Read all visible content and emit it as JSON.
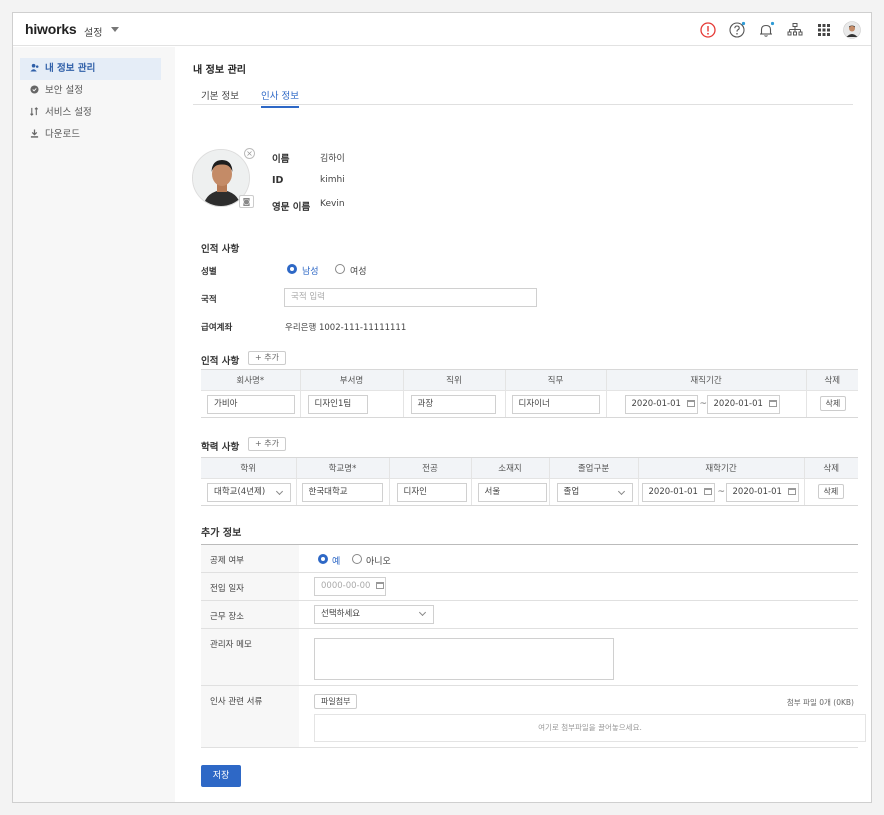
{
  "app": {
    "logo": "hiworks",
    "section": "설정"
  },
  "topbar": {
    "icons": [
      "alert-icon",
      "help-icon",
      "bell-icon",
      "org-chart-icon",
      "apps-grid-icon",
      "user-avatar"
    ]
  },
  "sidebar": {
    "items": [
      {
        "label": "내 정보 관리",
        "icon": "person-icon",
        "active": true
      },
      {
        "label": "보안 설정",
        "icon": "shield-icon",
        "active": false
      },
      {
        "label": "서비스 설정",
        "icon": "service-icon",
        "active": false
      },
      {
        "label": "다운로드",
        "icon": "download-icon",
        "active": false
      }
    ]
  },
  "main": {
    "title": "내 정보 관리",
    "tabs": [
      {
        "label": "기본 정보",
        "active": false
      },
      {
        "label": "인사 정보",
        "active": true
      }
    ]
  },
  "profile": {
    "name_label": "이름",
    "name_value": "김하이",
    "id_label": "ID",
    "id_value": "kimhi",
    "eng_label": "영문 이름",
    "eng_value": "Kevin"
  },
  "personal": {
    "title": "인적 사항",
    "gender_label": "성별",
    "gender_male": "남성",
    "gender_female": "여성",
    "gender_selected": "남성",
    "nation_label": "국적",
    "nation_placeholder": "국적 입력",
    "account_label": "급여계좌",
    "account_value": "우리은행 1002-111-11111111"
  },
  "career": {
    "title": "인적 사항",
    "add_label": "+ 추가",
    "headers": [
      "회사명*",
      "부서명",
      "직위",
      "직무",
      "재직기간",
      "삭제"
    ],
    "rows": [
      {
        "company": "가비아",
        "dept": "디자인1팀",
        "position": "과장",
        "duty": "디자이너",
        "start": "2020-01-01",
        "end": "2020-01-01",
        "delete": "삭제"
      }
    ]
  },
  "education": {
    "title": "학력 사항",
    "add_label": "+ 추가",
    "headers": [
      "학위",
      "학교명*",
      "전공",
      "소재지",
      "졸업구분",
      "재학기간",
      "삭제"
    ],
    "rows": [
      {
        "degree": "대학교(4년제)",
        "school": "한국대학교",
        "major": "디자인",
        "location": "서울",
        "status": "졸업",
        "start": "2020-01-01",
        "end": "2020-01-01",
        "delete": "삭제"
      }
    ]
  },
  "extra": {
    "title": "추가 정보",
    "deduct_label": "공제 여부",
    "deduct_yes": "예",
    "deduct_no": "아니오",
    "deduct_selected": "예",
    "move_label": "전입 일자",
    "move_placeholder": "0000-00-00",
    "work_label": "근무 장소",
    "work_select": "선택하세요",
    "memo_label": "관리자 메모",
    "docs_label": "인사 관련 서류",
    "attach_btn": "파일첨부",
    "attach_count": "첨부 파일 0개 (0KB)",
    "drop_hint": "여기로 첨부파일을 끌어놓으세요."
  },
  "save_label": "저장",
  "colors": {
    "accent": "#2e68c6",
    "alert": "#e53935",
    "dot": "#2e9bd6"
  }
}
